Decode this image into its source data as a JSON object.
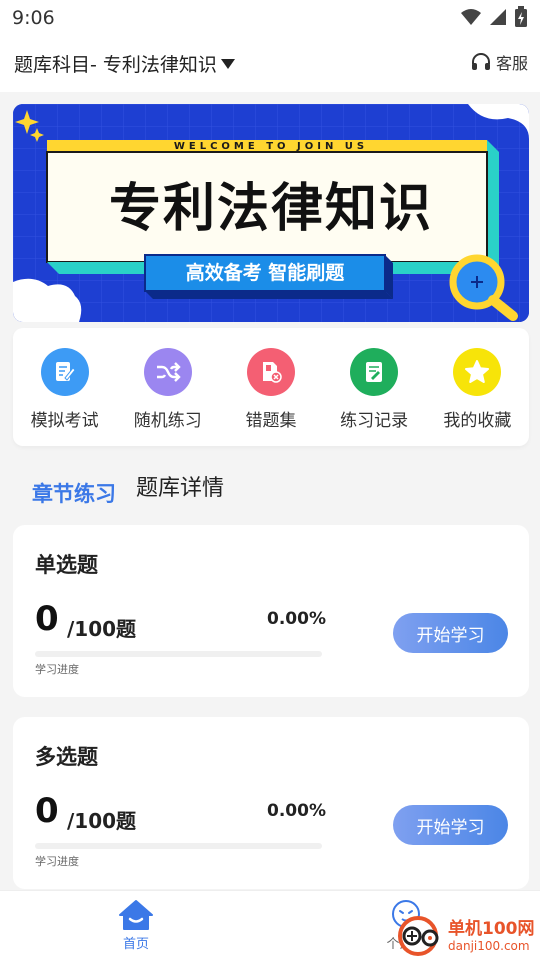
{
  "status": {
    "time": "9:06"
  },
  "header": {
    "subject": "题库科目- 专利法律知识",
    "service": "客服"
  },
  "banner": {
    "welcome": "WELCOME TO JOIN US",
    "title": "专利法律知识",
    "subtitle": "高效备考 智能刷题"
  },
  "quick": [
    {
      "label": "模拟考试",
      "icon": "exam-edit-icon",
      "color": "#3d9bf5"
    },
    {
      "label": "随机练习",
      "icon": "shuffle-icon",
      "color": "#9b86f0"
    },
    {
      "label": "错题集",
      "icon": "wrong-file-icon",
      "color": "#f45f73"
    },
    {
      "label": "练习记录",
      "icon": "record-note-icon",
      "color": "#1fae5c"
    },
    {
      "label": "我的收藏",
      "icon": "star-icon",
      "color": "#f7e409"
    }
  ],
  "tabs": {
    "active": "章节练习",
    "other": "题库详情"
  },
  "cards": [
    {
      "title": "单选题",
      "done": "0",
      "total": "/100题",
      "percent": "0.00%",
      "progress": 0,
      "progress_label": "学习进度",
      "button": "开始学习"
    },
    {
      "title": "多选题",
      "done": "0",
      "total": "/100题",
      "percent": "0.00%",
      "progress": 0,
      "progress_label": "学习进度",
      "button": "开始学习"
    }
  ],
  "nav": {
    "home": "首页",
    "profile": "个人中"
  },
  "watermark": {
    "line1": "单机100网",
    "line2": "danji100.com"
  }
}
